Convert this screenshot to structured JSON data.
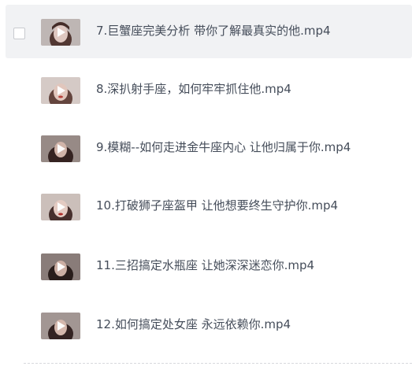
{
  "files": [
    {
      "name": "7.巨蟹座完美分析 带你了解最真实的他.mp4",
      "hovered": true,
      "checked": false,
      "thumb": "video-thumbnail"
    },
    {
      "name": "8.深扒射手座，如何牢牢抓住他.mp4",
      "hovered": false,
      "checked": false,
      "thumb": "video-thumbnail"
    },
    {
      "name": "9.模糊--如何走进金牛座内心 让他归属于你.mp4",
      "hovered": false,
      "checked": false,
      "thumb": "video-thumbnail"
    },
    {
      "name": "10.打破狮子座盔甲 让他想要终生守护你.mp4",
      "hovered": false,
      "checked": false,
      "thumb": "video-thumbnail"
    },
    {
      "name": "11.三招搞定水瓶座 让她深深迷恋你.mp4",
      "hovered": false,
      "checked": false,
      "thumb": "video-thumbnail"
    },
    {
      "name": "12.如何搞定处女座 永远依赖你.mp4",
      "hovered": false,
      "checked": false,
      "thumb": "video-thumbnail"
    }
  ],
  "colors": {
    "hover_bg": "#f1f2f4",
    "text": "#454d5a",
    "checkbox_border": "#c8cacf"
  }
}
